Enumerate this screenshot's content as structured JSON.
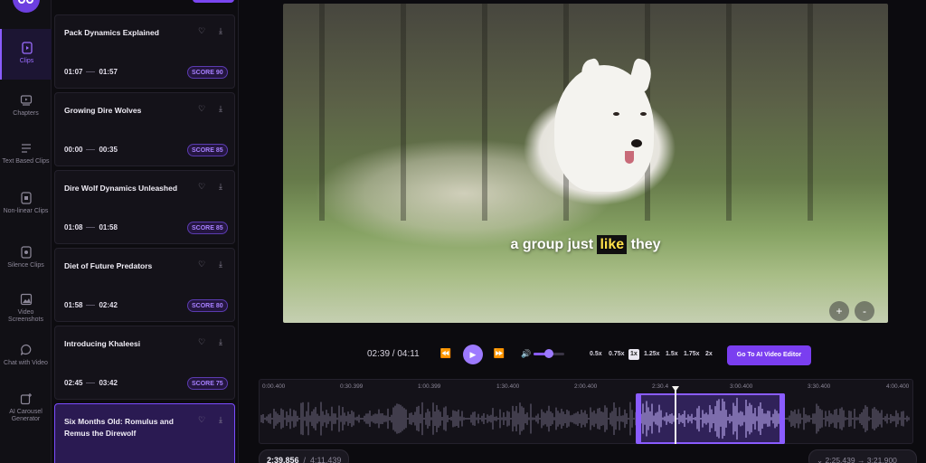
{
  "rail": {
    "items": [
      {
        "label": "Clips",
        "icon": "clips-icon",
        "active": true
      },
      {
        "label": "Chapters",
        "icon": "chapters-icon"
      },
      {
        "label": "Text Based Clips",
        "icon": "text-clips-icon"
      },
      {
        "label": "Non-linear Clips",
        "icon": "nonlinear-clips-icon"
      },
      {
        "label": "Silence Clips",
        "icon": "silence-clips-icon"
      },
      {
        "label": "Video Screenshots",
        "icon": "screenshot-icon"
      },
      {
        "label": "Chat with Video",
        "icon": "chat-icon"
      },
      {
        "label": "AI Carousel Generator",
        "icon": "carousel-icon"
      }
    ]
  },
  "clips": [
    {
      "title": "Pack Dynamics Explained",
      "start": "01:07",
      "end": "01:57",
      "score": "SCORE 90"
    },
    {
      "title": "Growing Dire Wolves",
      "start": "00:00",
      "end": "00:35",
      "score": "SCORE 85"
    },
    {
      "title": "Dire Wolf Dynamics Unleashed",
      "start": "01:08",
      "end": "01:58",
      "score": "SCORE 85"
    },
    {
      "title": "Diet of Future Predators",
      "start": "01:58",
      "end": "02:42",
      "score": "SCORE 80"
    },
    {
      "title": "Introducing Khaleesi",
      "start": "02:45",
      "end": "03:42",
      "score": "SCORE 75"
    },
    {
      "title": "Six Months Old: Romulus and Remus the Direwolf",
      "selected": true
    }
  ],
  "video": {
    "caption_before": "a group just ",
    "caption_highlight": "like",
    "caption_after": " they",
    "zoom_in": "+",
    "zoom_out": "-"
  },
  "controls": {
    "time": "02:39 / 04:11",
    "rewind": "⏪",
    "play": "▶",
    "forward": "⏩",
    "volume_icon": "🔊",
    "volume_level": 0.6,
    "speeds": [
      "0.5x",
      "0.75x",
      "1x",
      "1.25x",
      "1.5x",
      "1.75x",
      "2x"
    ],
    "selected_speed": "1x",
    "ai_editor_label": "Go To AI Video Editor"
  },
  "timeline": {
    "ticks": [
      "0:00.400",
      "0:30.399",
      "1:00.399",
      "1:30.400",
      "2:00.400",
      "2:30.4",
      "3:00.400",
      "3:30.400",
      "4:00.400"
    ],
    "position_current": "2:39.856",
    "position_total": "4:11.439",
    "range_text": "2:25.439 → 3:21.900"
  }
}
